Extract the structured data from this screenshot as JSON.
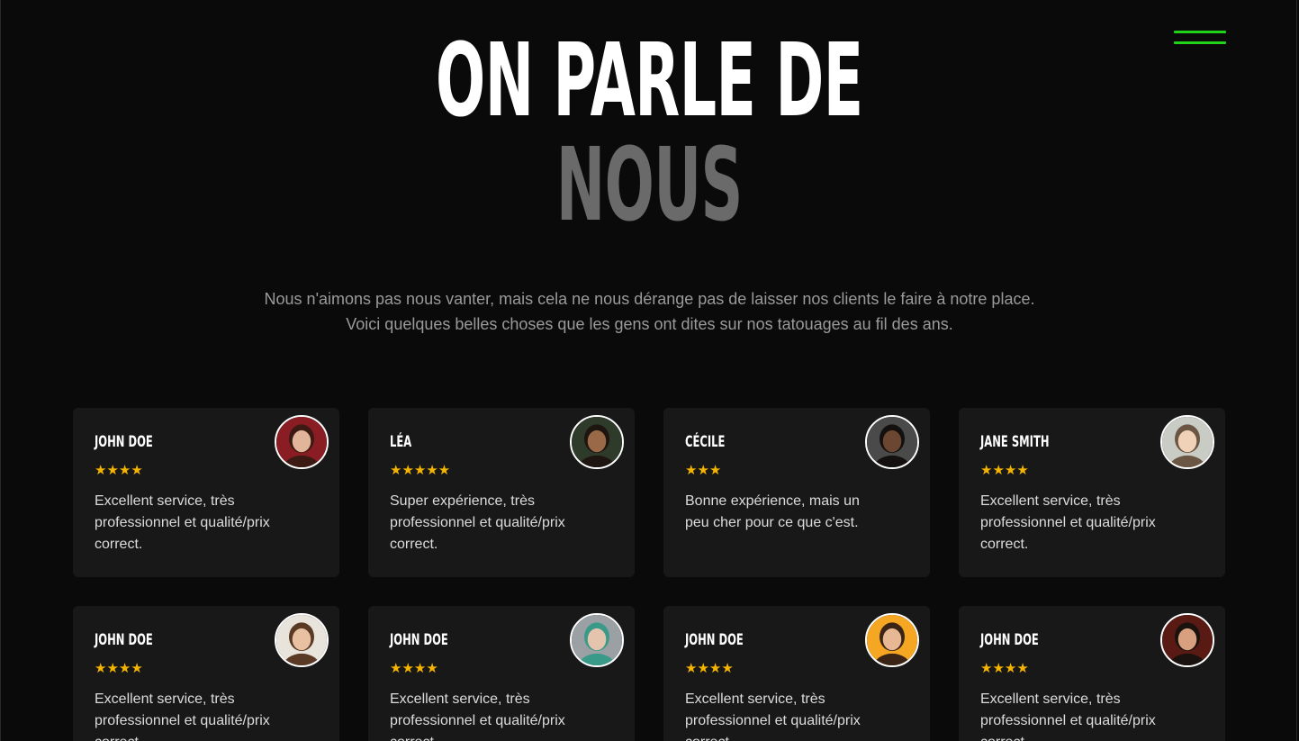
{
  "header": {
    "title_line1": "ON PARLE DE",
    "title_line2": "NOUS",
    "menu_icon": "hamburger-menu-icon",
    "accent_color": "#22d11a"
  },
  "intro": {
    "line1": "Nous n'aimons pas nous vanter, mais cela ne nous dérange pas de laisser nos clients le faire à notre place.",
    "line2": "Voici quelques belles choses que les gens ont dites sur nos tatouages au fil des ans."
  },
  "reviews": [
    {
      "name": "John Doe",
      "rating": 4,
      "stars": "★★★★",
      "text": "Excellent service, très professionnel et qualité/prix correct.",
      "avatar_bg": "#8a1c24",
      "avatar_skin": "#e2b49a",
      "avatar_hair": "#3a1a12"
    },
    {
      "name": "Léa",
      "rating": 5,
      "stars": "★★★★★",
      "text": "Super expérience, très professionnel et qualité/prix correct.",
      "avatar_bg": "#2e3a2a",
      "avatar_skin": "#9a6a48",
      "avatar_hair": "#1e1410"
    },
    {
      "name": "Cécile",
      "rating": 3,
      "stars": "★★★",
      "text": "Bonne expérience, mais un peu cher pour ce que c'est.",
      "avatar_bg": "#4a4a4a",
      "avatar_skin": "#6b4630",
      "avatar_hair": "#141010"
    },
    {
      "name": "Jane Smith",
      "rating": 4,
      "stars": "★★★★",
      "text": "Excellent service, très professionnel et qualité/prix correct.",
      "avatar_bg": "#c8ccc4",
      "avatar_skin": "#f0d2b8",
      "avatar_hair": "#6a5642"
    },
    {
      "name": "John Doe",
      "rating": 4,
      "stars": "★★★★",
      "text": "Excellent service, très professionnel et qualité/prix correct.",
      "avatar_bg": "#e8e4dc",
      "avatar_skin": "#e8c0a2",
      "avatar_hair": "#5a3a24"
    },
    {
      "name": "John Doe",
      "rating": 4,
      "stars": "★★★★",
      "text": "Excellent service, très professionnel et qualité/prix correct.",
      "avatar_bg": "#9aa0a4",
      "avatar_skin": "#e4c4ac",
      "avatar_hair": "#3a9a8a"
    },
    {
      "name": "John Doe",
      "rating": 4,
      "stars": "★★★★",
      "text": "Excellent service, très professionnel et qualité/prix correct.",
      "avatar_bg": "#f5a623",
      "avatar_skin": "#e8b894",
      "avatar_hair": "#3a2416"
    },
    {
      "name": "John Doe",
      "rating": 4,
      "stars": "★★★★",
      "text": "Excellent service, très professionnel et qualité/prix correct.",
      "avatar_bg": "#5a1a14",
      "avatar_skin": "#d8a07e",
      "avatar_hair": "#1a120e"
    }
  ],
  "colors": {
    "background": "#0a0a0a",
    "card": "#181818",
    "star": "#f4b400",
    "subtitle_gray": "#6a6a6a"
  }
}
